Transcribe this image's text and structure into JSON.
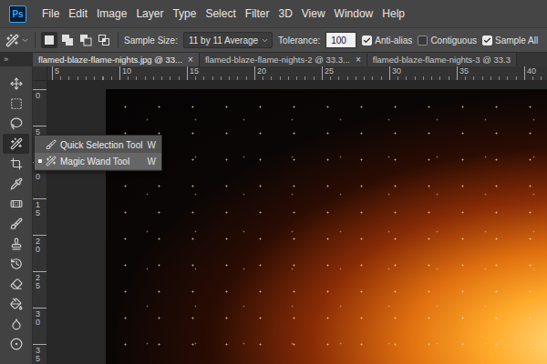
{
  "app": {
    "logo": "Ps"
  },
  "menu": [
    "File",
    "Edit",
    "Image",
    "Layer",
    "Type",
    "Select",
    "Filter",
    "3D",
    "View",
    "Window",
    "Help"
  ],
  "options_bar": {
    "selection_modes": [
      {
        "selected": true
      },
      {
        "selected": false
      },
      {
        "selected": false
      },
      {
        "selected": false
      }
    ],
    "sample_size_label": "Sample Size:",
    "sample_size": "11 by 11 Average",
    "tolerance_label": "Tolerance:",
    "tolerance": "100",
    "checkboxes": [
      {
        "label": "Anti-alias",
        "checked": true
      },
      {
        "label": "Contiguous",
        "checked": false
      },
      {
        "label": "Sample All",
        "checked": true
      }
    ]
  },
  "tabs": [
    {
      "label": "flamed-blaze-flame-nights.jpg @ 33...",
      "close": "×",
      "selected": true
    },
    {
      "label": "flamed-blaze-flame-nights-2 @ 33.3...",
      "close": "×",
      "selected": false
    },
    {
      "label": "flamed-blaze-flame-nights-3 @ 33.3",
      "close": "",
      "selected": false
    }
  ],
  "toolbar": {
    "collapse": "»",
    "tools": [
      {
        "selected": false
      },
      {
        "selected": false
      },
      {
        "selected": false
      },
      {
        "selected": true
      },
      {
        "selected": false
      },
      {
        "selected": false
      },
      {
        "selected": false
      },
      {
        "selected": false
      },
      {
        "selected": false
      },
      {
        "selected": false
      },
      {
        "selected": false
      },
      {
        "selected": false
      },
      {
        "selected": false
      },
      {
        "selected": false
      }
    ]
  },
  "ruler": {
    "horizontal": [
      "5",
      "10",
      "15",
      "20",
      "25",
      "30",
      "35",
      "40"
    ],
    "vertical": [
      "0",
      "5",
      "10",
      "15",
      "20",
      "25",
      "30",
      "35"
    ]
  },
  "tool_flyout": [
    {
      "label": "Quick Selection Tool",
      "shortcut": "W",
      "selected": false
    },
    {
      "label": "Magic Wand Tool",
      "shortcut": "W",
      "selected": true
    }
  ]
}
